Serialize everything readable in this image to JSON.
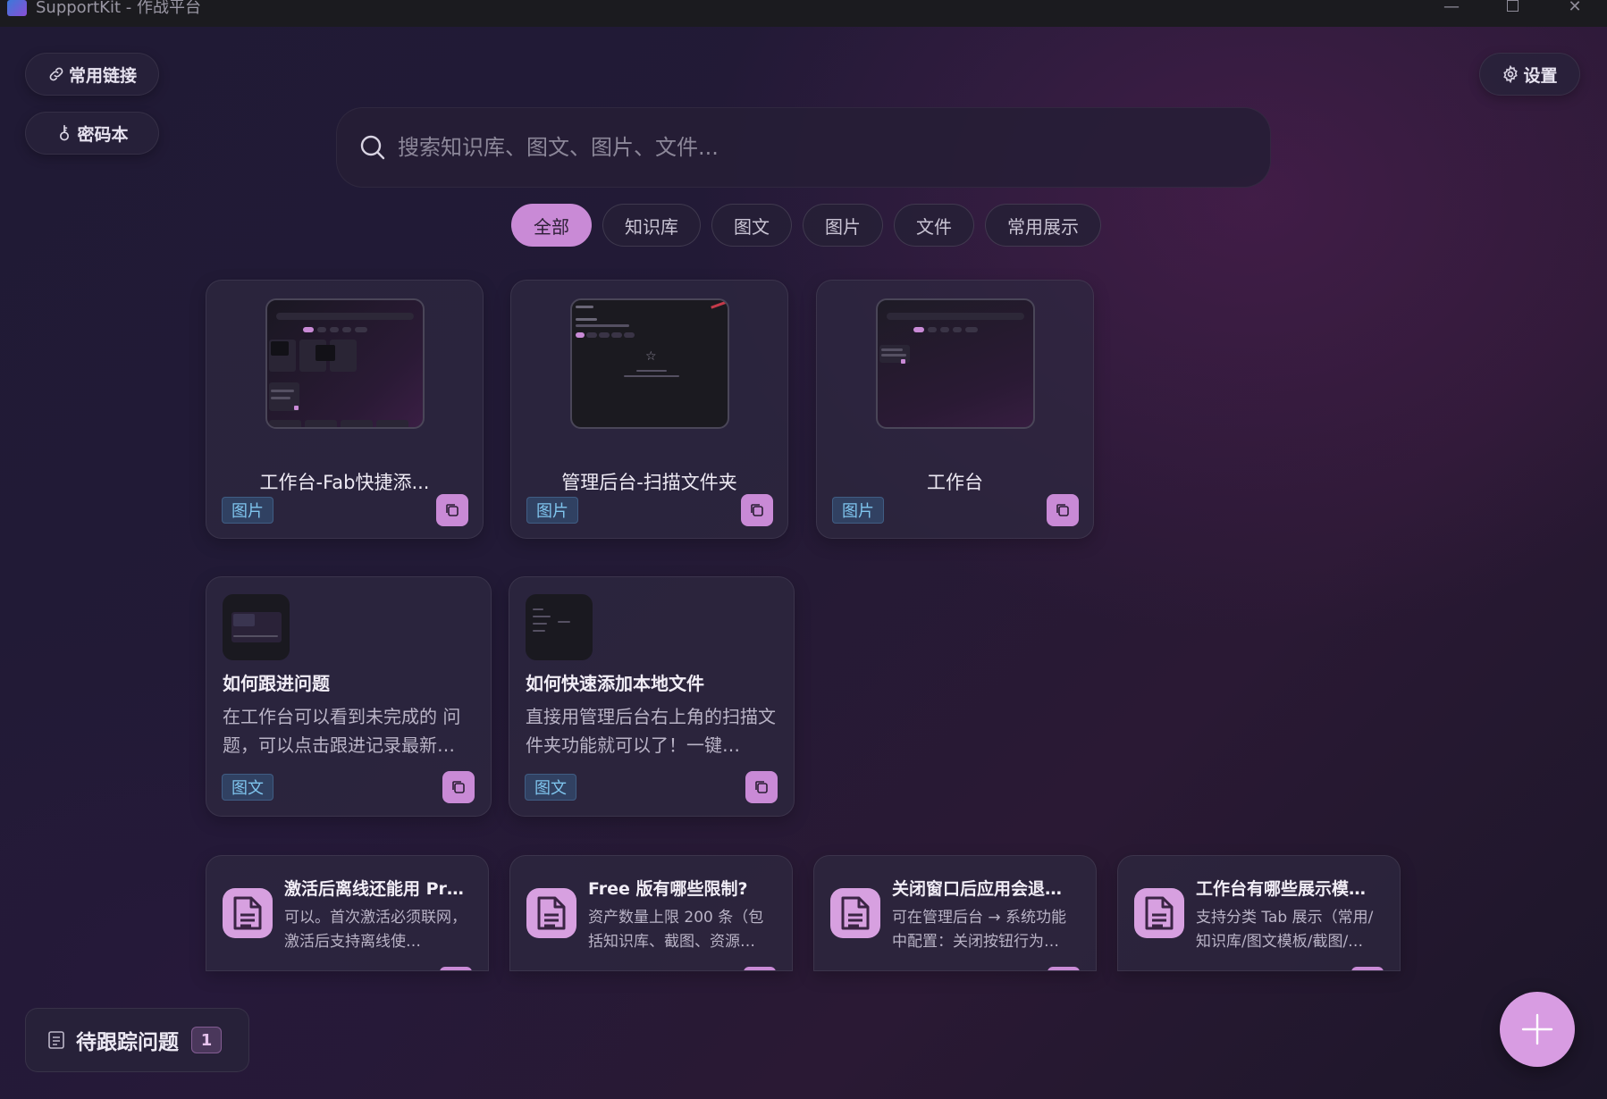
{
  "window": {
    "title": "SupportKit - 作战平台"
  },
  "sidebar": {
    "links_label": "常用链接",
    "passwords_label": "密码本"
  },
  "header": {
    "settings_label": "设置"
  },
  "search": {
    "placeholder": "搜索知识库、图文、图片、文件..."
  },
  "tabs": [
    {
      "label": "全部",
      "active": true
    },
    {
      "label": "知识库"
    },
    {
      "label": "图文"
    },
    {
      "label": "图片"
    },
    {
      "label": "文件"
    },
    {
      "label": "常用展示"
    }
  ],
  "image_cards": [
    {
      "title": "工作台-Fab快捷添...",
      "tag": "图片"
    },
    {
      "title": "管理后台-扫描文件夹",
      "tag": "图片"
    },
    {
      "title": "工作台",
      "tag": "图片"
    }
  ],
  "article_cards": [
    {
      "title": "如何跟进问题",
      "desc": "在工作台可以看到未完成的 问题，可以点击跟进记录最新…",
      "tag": "图文"
    },
    {
      "title": "如何快速添加本地文件",
      "desc": "直接用管理后台右上角的扫描文件夹功能就可以了！一键…",
      "tag": "图文"
    }
  ],
  "faq_cards": [
    {
      "title": "激活后离线还能用 Pr…",
      "desc": "可以。首次激活必须联网，激活后支持离线使…"
    },
    {
      "title": "Free 版有哪些限制?",
      "desc": "资产数量上限 200 条（包括知识库、截图、资源…"
    },
    {
      "title": "关闭窗口后应用会退…",
      "desc": "可在管理后台 → 系统功能中配置：关闭按钮行为…"
    },
    {
      "title": "工作台有哪些展示模…",
      "desc": "支持分类 Tab 展示（常用/知识库/图文模板/截图/…"
    }
  ],
  "footer": {
    "track_label": "待跟踪问题",
    "track_count": "1"
  },
  "colors": {
    "accent": "#c98ad6",
    "tag_text": "#7fc5ee",
    "background": "#221a36"
  },
  "icons": {
    "links": "link-icon",
    "passwords": "key-icon",
    "settings": "gear-icon",
    "search": "search-icon",
    "copy": "copy-icon",
    "document": "document-icon",
    "fab": "plus-icon",
    "track": "notes-icon"
  }
}
